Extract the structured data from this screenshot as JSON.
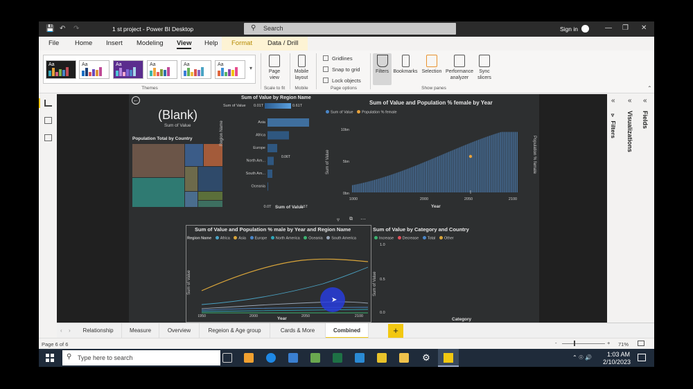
{
  "window": {
    "title": "1 st project - Power BI Desktop",
    "search_placeholder": "Search",
    "signin": "Sign in"
  },
  "menu": [
    "File",
    "Home",
    "Insert",
    "Modeling",
    "View",
    "Help",
    "Format",
    "Data / Drill"
  ],
  "ribbon": {
    "themes_label": "Themes",
    "theme_aa": "Aa",
    "page_view": "Page view",
    "scale_label": "Scale to fit",
    "mobile_layout": "Mobile layout",
    "mobile_label": "Mobile",
    "gridlines": "Gridlines",
    "snap": "Snap to grid",
    "lock": "Lock objects",
    "page_options": "Page options",
    "filters": "Filters",
    "bookmarks": "Bookmarks",
    "selection": "Selection",
    "perf": "Performance analyzer",
    "sync": "Sync slicers",
    "show_panes": "Show panes"
  },
  "card": {
    "value": "(Blank)",
    "label": "Sum of Value"
  },
  "treemap": {
    "title": "Population Total by Country"
  },
  "bar_chart": {
    "title": "Sum of Value by Region Name",
    "legend_left": "Sum of Value",
    "legend_min": "0.01T",
    "legend_max": "0.61T",
    "categories": [
      "Asia",
      "Africa",
      "Europe",
      "North Am...",
      "South Am...",
      "Oceania"
    ],
    "data_label": "0.06T",
    "ylabel": "Region Name",
    "xlabel": "Sum of Value",
    "xticks": [
      "0.0T",
      "0.5T"
    ]
  },
  "combo_chart": {
    "title": "Sum of Value and Population % female by Year",
    "legend": [
      "Sum of Value",
      "Population % female"
    ],
    "yticks": [
      "10bn",
      "5bn",
      "0bn"
    ],
    "xticks": [
      "1000",
      "2000",
      "2050",
      "2100"
    ],
    "ylabel": "Sum of Value",
    "y2label": "Population % female",
    "xlabel": "Year"
  },
  "line_chart": {
    "title": "Sum of Value and Population % male by Year and Region Name",
    "legend_title": "Region Name",
    "legend": [
      "Africa",
      "Asia",
      "Europe",
      "North America",
      "Oceania",
      "South America"
    ],
    "ylabel": "Sum of Value",
    "xlabel": "Year",
    "xticks": [
      "1950",
      "2000",
      "2050",
      "2100"
    ]
  },
  "waterfall": {
    "title": "Sum of Value by Category and Country",
    "legend": [
      "Increase",
      "Decrease",
      "Total",
      "Other"
    ],
    "yticks": [
      "1.0",
      "0.5",
      "0.0"
    ],
    "ylabel": "Sum of Value",
    "xlabel": "Category"
  },
  "panes": {
    "filters": "Filters",
    "visualizations": "Visualizations",
    "fields": "Fields"
  },
  "tabs": [
    "Relationship",
    "Measure",
    "Overview",
    "Regeion & Age group",
    "Cards & More",
    "Combined"
  ],
  "status": {
    "page": "Page 6 of 6",
    "zoom": "71%"
  },
  "taskbar": {
    "search": "Type here to search",
    "time": "1:03 AM",
    "date": "2/10/2023"
  },
  "colors": {
    "bar": "#4a86c8",
    "accent": "#f2c811",
    "dark": "#2b2b2b"
  }
}
